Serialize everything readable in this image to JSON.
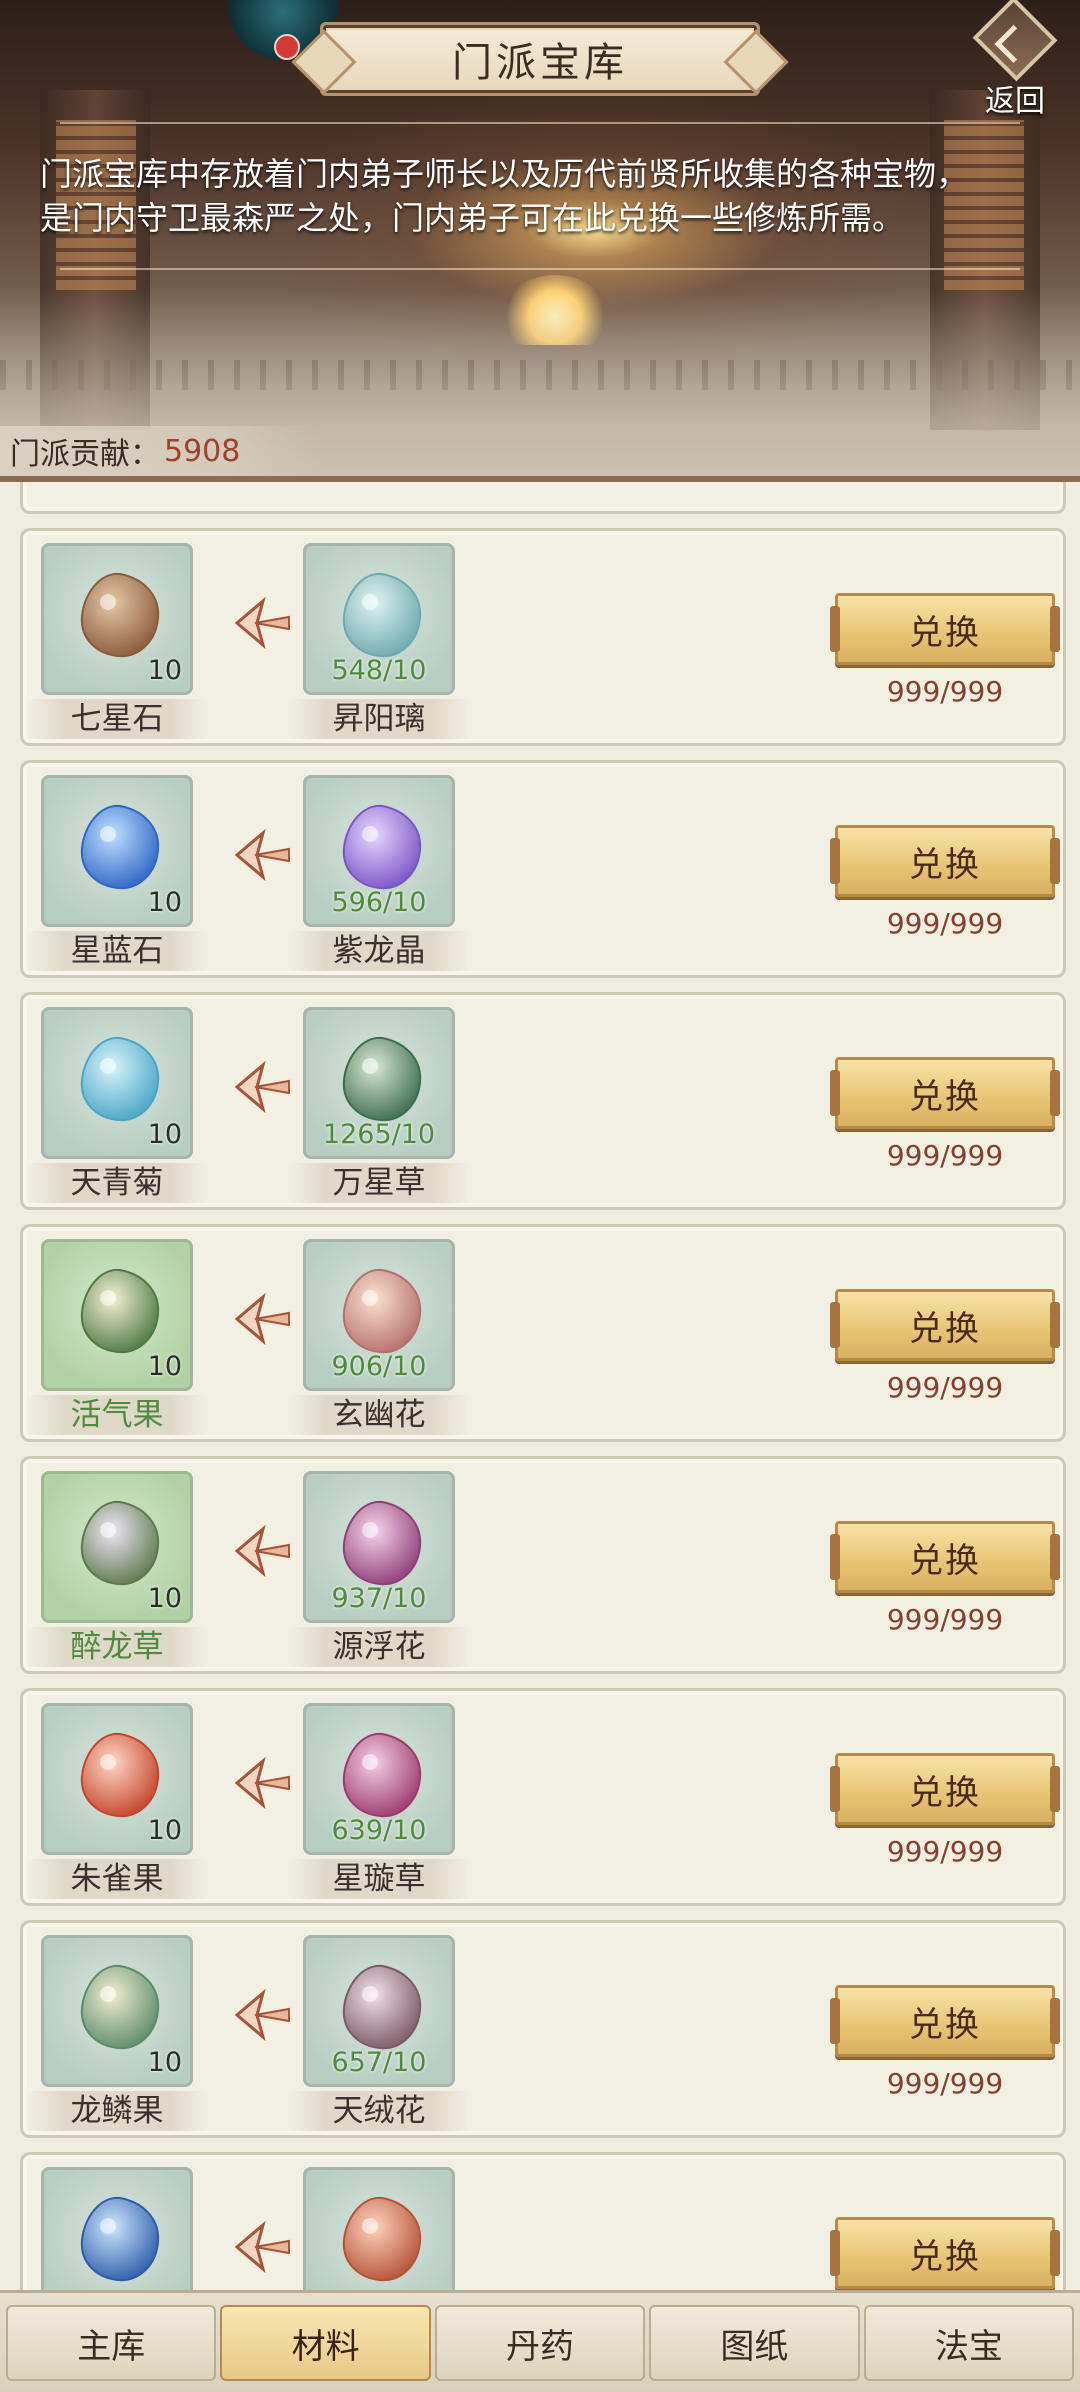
{
  "header": {
    "title": "门派宝库",
    "back_label": "返回",
    "description_line1": "门派宝库中存放着门内弟子师长以及历代前贤所收集的各种宝物，",
    "description_line2": "是门内守卫最森严之处，门内弟子可在此兑换一些修炼所需。",
    "contribution_label": "门派贡献：",
    "contribution_value": "5908"
  },
  "rows": [
    {
      "source": {
        "name": "七星石",
        "count": "10",
        "icon": "brown-stone-icon"
      },
      "target": {
        "name": "昇阳璃",
        "count": "548/10",
        "icon": "crystal-ore-icon"
      },
      "button": "兑换",
      "stock": "999/999",
      "source_green": false
    },
    {
      "source": {
        "name": "星蓝石",
        "count": "10",
        "icon": "blue-gem-icon"
      },
      "target": {
        "name": "紫龙晶",
        "count": "596/10",
        "icon": "purple-crystal-icon"
      },
      "button": "兑换",
      "stock": "999/999",
      "source_green": false
    },
    {
      "source": {
        "name": "天青菊",
        "count": "10",
        "icon": "cyan-chrysanthemum-icon"
      },
      "target": {
        "name": "万星草",
        "count": "1265/10",
        "icon": "star-herb-icon"
      },
      "button": "兑换",
      "stock": "999/999",
      "source_green": false
    },
    {
      "source": {
        "name": "活气果",
        "count": "10",
        "icon": "vital-fruit-icon"
      },
      "target": {
        "name": "玄幽花",
        "count": "906/10",
        "icon": "mystic-flower-icon"
      },
      "button": "兑换",
      "stock": "999/999",
      "source_green": true
    },
    {
      "source": {
        "name": "醉龙草",
        "count": "10",
        "icon": "dragon-grass-icon"
      },
      "target": {
        "name": "源浮花",
        "count": "937/10",
        "icon": "floating-flower-icon"
      },
      "button": "兑换",
      "stock": "999/999",
      "source_green": true
    },
    {
      "source": {
        "name": "朱雀果",
        "count": "10",
        "icon": "red-berry-icon"
      },
      "target": {
        "name": "星璇草",
        "count": "639/10",
        "icon": "swirl-flower-icon"
      },
      "button": "兑换",
      "stock": "999/999",
      "source_green": false
    },
    {
      "source": {
        "name": "龙鳞果",
        "count": "10",
        "icon": "scale-fruit-icon"
      },
      "target": {
        "name": "天绒花",
        "count": "657/10",
        "icon": "velvet-flower-icon"
      },
      "button": "兑换",
      "stock": "999/999",
      "source_green": false
    },
    {
      "source": {
        "name": "",
        "count": "",
        "icon": "blue-berry-icon"
      },
      "target": {
        "name": "",
        "count": "",
        "icon": "red-cone-icon"
      },
      "button": "兑换",
      "stock": "",
      "source_green": false
    }
  ],
  "tabs": [
    {
      "label": "主库",
      "active": false
    },
    {
      "label": "材料",
      "active": true
    },
    {
      "label": "丹药",
      "active": false
    },
    {
      "label": "图纸",
      "active": false
    },
    {
      "label": "法宝",
      "active": false
    }
  ],
  "colors": {
    "accent_gold": "#e8c777",
    "stock_red": "#8a3f2c",
    "owned_green": "#4f8a3d"
  }
}
